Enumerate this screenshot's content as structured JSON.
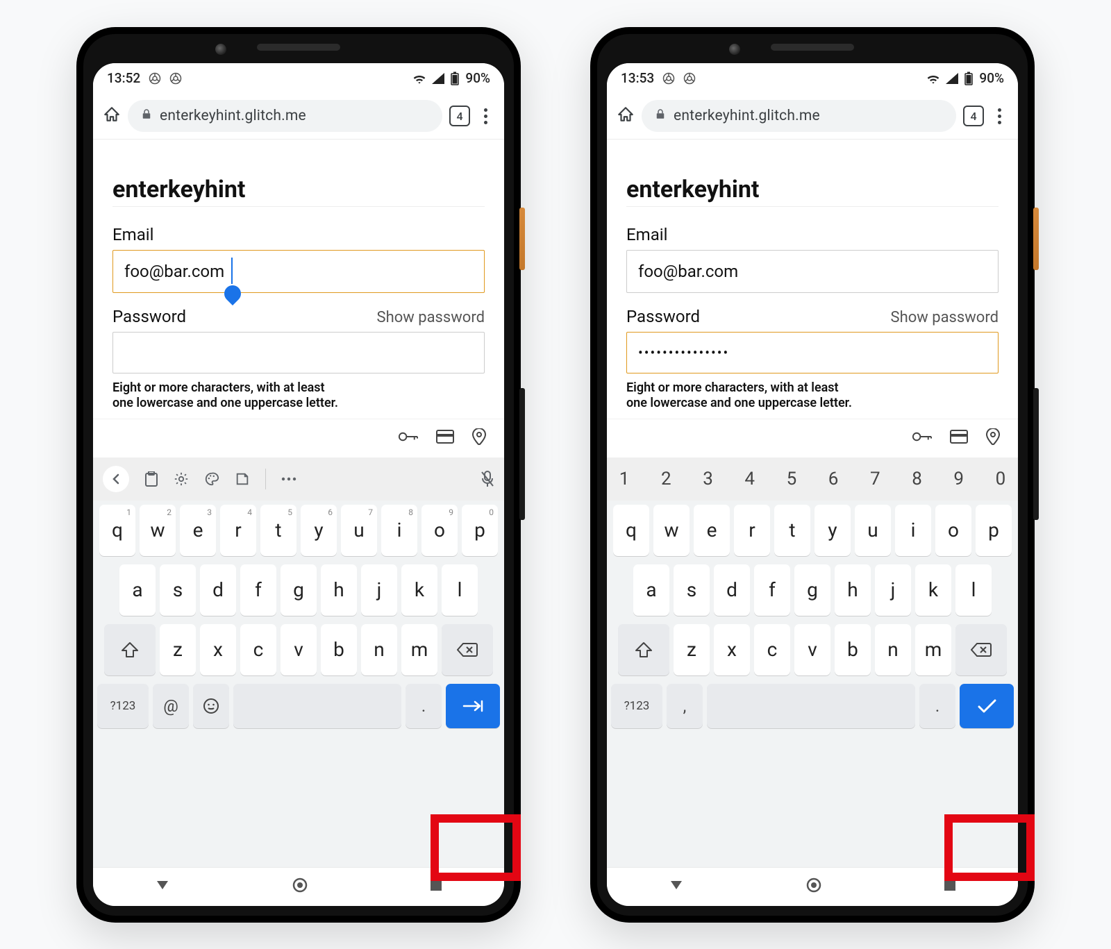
{
  "phones": [
    {
      "statusbar": {
        "time": "13:52",
        "battery": "90%"
      },
      "omnibox": {
        "url": "enterkeyhint.glitch.me",
        "tab_count": "4"
      },
      "page": {
        "title": "enterkeyhint",
        "email_label": "Email",
        "email_value": "foo@bar.com",
        "email_focused": true,
        "show_caret": true,
        "password_label": "Password",
        "show_password_label": "Show password",
        "password_focused": false,
        "password_value": "",
        "hint_line1": "Eight or more characters, with at least",
        "hint_line2": "one lowercase and one uppercase letter."
      },
      "keyboard": {
        "top_style": "tools",
        "row1": [
          "q",
          "w",
          "e",
          "r",
          "t",
          "y",
          "u",
          "i",
          "o",
          "p"
        ],
        "row1_sup": [
          "1",
          "2",
          "3",
          "4",
          "5",
          "6",
          "7",
          "8",
          "9",
          "0"
        ],
        "row2": [
          "a",
          "s",
          "d",
          "f",
          "g",
          "h",
          "j",
          "k",
          "l"
        ],
        "row3": [
          "z",
          "x",
          "c",
          "v",
          "b",
          "n",
          "m"
        ],
        "bottom": {
          "sym": "?123",
          "left_punc": "@",
          "right_punc": ".",
          "face": true
        },
        "enter_icon": "next"
      }
    },
    {
      "statusbar": {
        "time": "13:53",
        "battery": "90%"
      },
      "omnibox": {
        "url": "enterkeyhint.glitch.me",
        "tab_count": "4"
      },
      "page": {
        "title": "enterkeyhint",
        "email_label": "Email",
        "email_value": "foo@bar.com",
        "email_focused": false,
        "show_caret": false,
        "password_label": "Password",
        "show_password_label": "Show password",
        "password_focused": true,
        "password_value": "•••••••••••••••",
        "hint_line1": "Eight or more characters, with at least",
        "hint_line2": "one lowercase and one uppercase letter."
      },
      "keyboard": {
        "top_style": "numbers",
        "top_numbers": [
          "1",
          "2",
          "3",
          "4",
          "5",
          "6",
          "7",
          "8",
          "9",
          "0"
        ],
        "row1": [
          "q",
          "w",
          "e",
          "r",
          "t",
          "y",
          "u",
          "i",
          "o",
          "p"
        ],
        "row1_sup": [],
        "row2": [
          "a",
          "s",
          "d",
          "f",
          "g",
          "h",
          "j",
          "k",
          "l"
        ],
        "row3": [
          "z",
          "x",
          "c",
          "v",
          "b",
          "n",
          "m"
        ],
        "bottom": {
          "sym": "?123",
          "left_punc": ",",
          "right_punc": ".",
          "face": false
        },
        "enter_icon": "done"
      }
    }
  ]
}
